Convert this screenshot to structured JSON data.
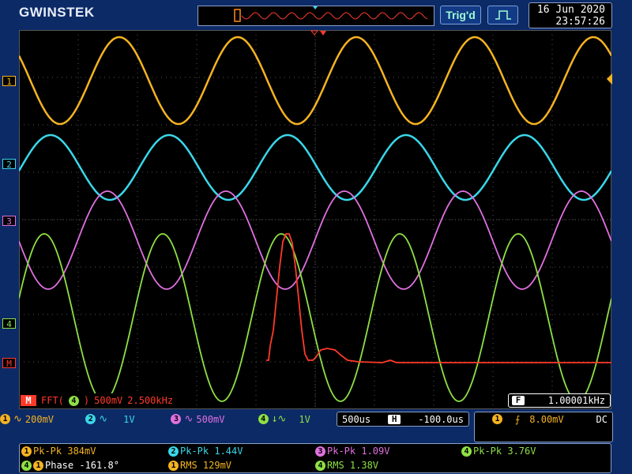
{
  "brand": "GWINSTEK",
  "trigger_status": "Trig'd",
  "datetime": {
    "date": "16 Jun 2020",
    "time": "23:57:26"
  },
  "channel_markers": [
    {
      "id": "1",
      "color": "#f5b321"
    },
    {
      "id": "2",
      "color": "#39d7ea"
    },
    {
      "id": "3",
      "color": "#e070e0"
    },
    {
      "id": "4",
      "color": "#8ee045"
    },
    {
      "id": "M",
      "color": "#ff3a2a"
    }
  ],
  "math": {
    "badge": "M",
    "func": "FFT(",
    "source": "4",
    "close": ")",
    "scale": "500mV",
    "span": "2.500kHz"
  },
  "frequency": {
    "badge": "F",
    "value": "1.00001kHz"
  },
  "channels": [
    {
      "id": "1",
      "coupling": "∿",
      "scale": "200mV",
      "color": "#f5b321"
    },
    {
      "id": "2",
      "coupling": "∿",
      "scale": "1V",
      "color": "#39d7ea"
    },
    {
      "id": "3",
      "coupling": "∿",
      "scale": "500mV",
      "color": "#e070e0"
    },
    {
      "id": "4",
      "coupling": "↓∿",
      "scale": "1V",
      "color": "#8ee045"
    }
  ],
  "timebase": {
    "scale": "500us",
    "h_badge": "H",
    "position": "-100.0us"
  },
  "trigger": {
    "source": "1",
    "level": "8.00mV",
    "coupling": "DC"
  },
  "measurements": [
    {
      "src": "1",
      "label": "Pk-Pk 384mV",
      "color": "#f5b321"
    },
    {
      "src": "2",
      "label": "Pk-Pk 1.44V",
      "color": "#39d7ea"
    },
    {
      "src": "3",
      "label": "Pk-Pk 1.09V",
      "color": "#e070e0"
    },
    {
      "src": "4",
      "label": "Pk-Pk 3.76V",
      "color": "#8ee045"
    },
    {
      "src": "4",
      "src2": "1",
      "label": "Phase -161.8°",
      "color": "#f5b321"
    },
    {
      "src": "1",
      "label": "RMS 129mV",
      "color": "#f5b321"
    },
    {
      "src": "4",
      "label": "RMS 1.38V",
      "color": "#8ee045"
    }
  ]
}
